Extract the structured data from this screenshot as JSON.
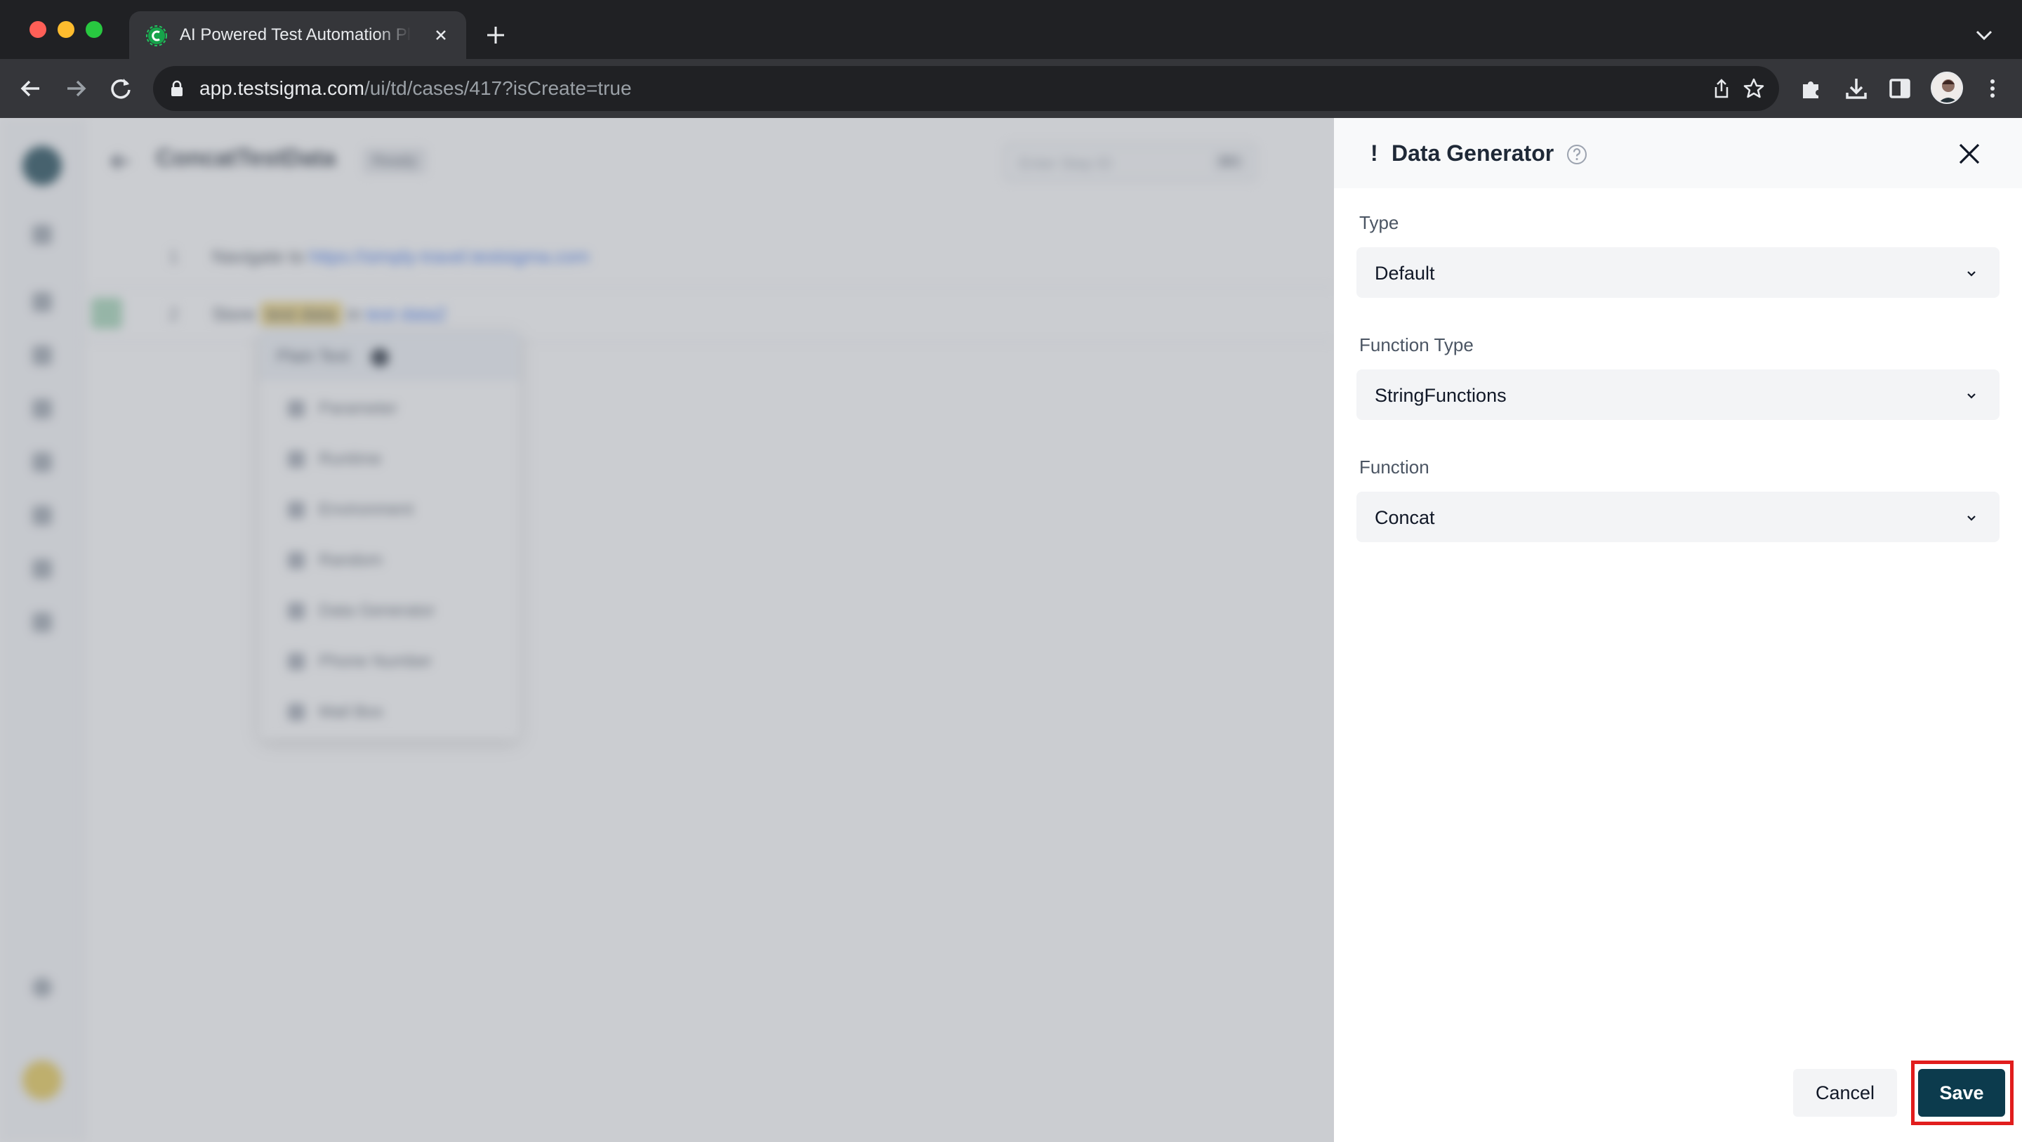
{
  "browser": {
    "tab_title": "AI Powered Test Automation Platform",
    "url_host": "app.testsigma.com",
    "url_path": "/ui/td/cases/417?isCreate=true"
  },
  "background_page": {
    "title": "ConcatTestData",
    "badge": "Ready",
    "search_placeholder": "Enter Step ID",
    "search_kbd": "⌘K",
    "steps": [
      {
        "num": "1",
        "action": "Navigate to",
        "target": "https://simply-travel.testsigma.com"
      },
      {
        "num": "2",
        "action": "Store",
        "value": "test data",
        "connector": "in",
        "variable": "test data2"
      }
    ],
    "test_data_menu": {
      "header": "Plain Text",
      "items": [
        "Parameter",
        "Runtime",
        "Environment",
        "Random",
        "Data Generator",
        "Phone Number",
        "Mail Box"
      ]
    }
  },
  "drawer": {
    "title_prefix": "!",
    "title": "Data Generator",
    "fields": [
      {
        "label": "Type",
        "value": "Default"
      },
      {
        "label": "Function Type",
        "value": "StringFunctions"
      },
      {
        "label": "Function",
        "value": "Concat"
      }
    ],
    "cancel_label": "Cancel",
    "save_label": "Save"
  },
  "colors": {
    "primary": "#0c3b4d",
    "highlight": "#e11d1d"
  }
}
